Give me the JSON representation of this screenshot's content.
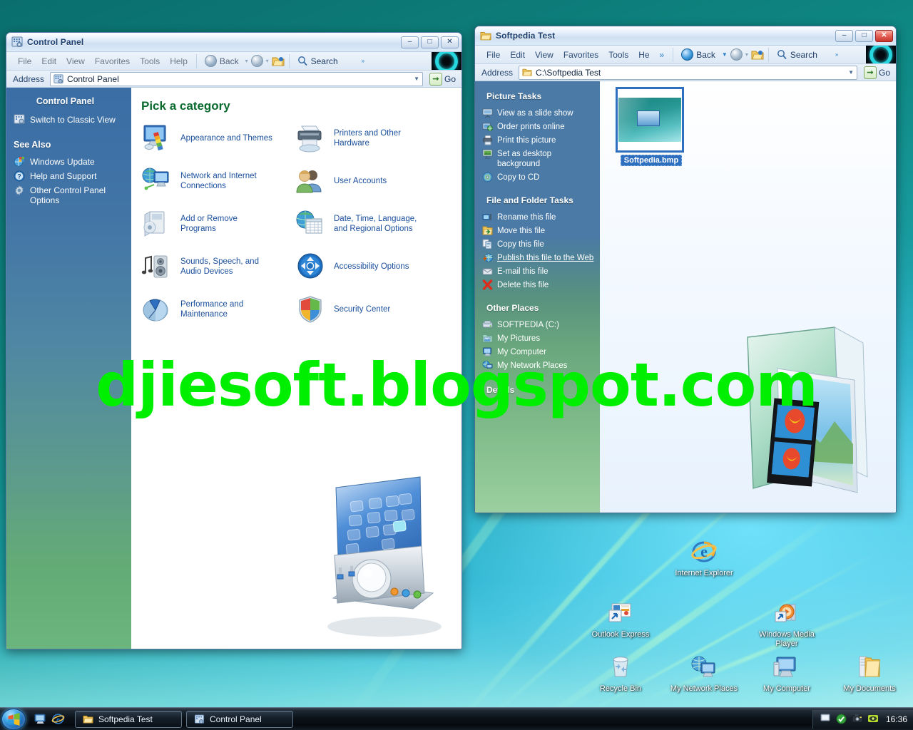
{
  "desktop": {
    "watermark_text": "djiesoft.blogspot.com",
    "watermark_color": "#00ee00",
    "icons": [
      {
        "name": "internet-explorer",
        "label": "Internet Explorer"
      },
      {
        "name": "outlook-express",
        "label": "Outlook Express"
      },
      {
        "name": "windows-media-player",
        "label": "Windows Media Player"
      },
      {
        "name": "recycle-bin",
        "label": "Recycle Bin"
      },
      {
        "name": "my-network-places",
        "label": "My Network Places"
      },
      {
        "name": "my-computer",
        "label": "My Computer"
      },
      {
        "name": "my-documents",
        "label": "My Documents"
      }
    ]
  },
  "control_panel_window": {
    "title": "Control Panel",
    "window_buttons": {
      "minimize": "–",
      "maximize": "□",
      "close": "✕"
    },
    "menu": [
      "File",
      "Edit",
      "View",
      "Favorites",
      "Tools",
      "Help"
    ],
    "toolbar": {
      "back_label": "Back",
      "search_label": "Search",
      "chevrons": "»"
    },
    "address": {
      "label": "Address",
      "value": "Control Panel",
      "go_label": "Go"
    },
    "sidebar": {
      "heading": "Control Panel",
      "classic_view": "Switch to Classic View",
      "see_also_heading": "See Also",
      "see_also": [
        {
          "name": "windows-update",
          "label": "Windows Update"
        },
        {
          "name": "help-and-support",
          "label": "Help and Support"
        },
        {
          "name": "other-control-panel-options",
          "label": "Other Control Panel Options"
        }
      ]
    },
    "main": {
      "heading": "Pick a category",
      "categories": [
        {
          "name": "appearance-and-themes",
          "label": "Appearance and Themes"
        },
        {
          "name": "printers-and-other-hardware",
          "label": "Printers and Other Hardware"
        },
        {
          "name": "network-and-internet-connections",
          "label": "Network and Internet Connections"
        },
        {
          "name": "user-accounts",
          "label": "User Accounts"
        },
        {
          "name": "add-or-remove-programs",
          "label": "Add or Remove Programs"
        },
        {
          "name": "date-time-language-regional-options",
          "label": "Date, Time, Language, and Regional Options"
        },
        {
          "name": "sounds-speech-audio-devices",
          "label": "Sounds, Speech, and Audio Devices"
        },
        {
          "name": "accessibility-options",
          "label": "Accessibility Options"
        },
        {
          "name": "performance-and-maintenance",
          "label": "Performance and Maintenance"
        },
        {
          "name": "security-center",
          "label": "Security Center"
        }
      ]
    }
  },
  "explorer_window": {
    "title": "Softpedia Test",
    "window_buttons": {
      "minimize": "–",
      "maximize": "□",
      "close": "✕"
    },
    "menu": [
      "File",
      "Edit",
      "View",
      "Favorites",
      "Tools",
      "He",
      "»"
    ],
    "toolbar": {
      "back_label": "Back",
      "search_label": "Search",
      "chevrons": "»"
    },
    "address": {
      "label": "Address",
      "value": "C:\\Softpedia Test",
      "go_label": "Go"
    },
    "sidebar": {
      "picture_tasks_heading": "Picture Tasks",
      "picture_tasks": [
        {
          "name": "view-as-slide-show",
          "label": "View as a slide show"
        },
        {
          "name": "order-prints-online",
          "label": "Order prints online"
        },
        {
          "name": "print-this-picture",
          "label": "Print this picture"
        },
        {
          "name": "set-as-desktop-background",
          "label": "Set as desktop background"
        },
        {
          "name": "copy-to-cd",
          "label": "Copy to CD"
        }
      ],
      "file_tasks_heading": "File and Folder Tasks",
      "file_tasks": [
        {
          "name": "rename-this-file",
          "label": "Rename this file",
          "underline": false
        },
        {
          "name": "move-this-file",
          "label": "Move this file",
          "underline": false
        },
        {
          "name": "copy-this-file",
          "label": "Copy this file",
          "underline": false
        },
        {
          "name": "publish-this-file-to-the-web",
          "label": "Publish this file to the Web",
          "underline": true
        },
        {
          "name": "email-this-file",
          "label": "E-mail this file",
          "underline": false
        },
        {
          "name": "delete-this-file",
          "label": "Delete this file",
          "underline": false
        }
      ],
      "other_places_heading": "Other Places",
      "other_places": [
        {
          "name": "softpedia-drive",
          "label": "SOFTPEDIA (C:)"
        },
        {
          "name": "my-pictures",
          "label": "My Pictures"
        },
        {
          "name": "my-computer",
          "label": "My Computer"
        },
        {
          "name": "my-network-places",
          "label": "My Network Places"
        }
      ],
      "details_heading": "Details"
    },
    "files": [
      {
        "name": "softpedia-bmp",
        "label": "Softpedia.bmp",
        "selected": true
      }
    ]
  },
  "taskbar": {
    "start_label": "Start",
    "quick_launch": [
      {
        "name": "show-desktop",
        "label": "Show Desktop"
      },
      {
        "name": "internet-explorer",
        "label": "Internet Explorer"
      }
    ],
    "tasks": [
      {
        "name": "task-softpedia-test",
        "label": "Softpedia Test",
        "active": true
      },
      {
        "name": "task-control-panel",
        "label": "Control Panel",
        "active": false
      }
    ],
    "tray": {
      "clock": "16:36",
      "icons": [
        "monitor-icon",
        "shield-ok-icon",
        "camera-icon",
        "eye-icon"
      ]
    }
  }
}
